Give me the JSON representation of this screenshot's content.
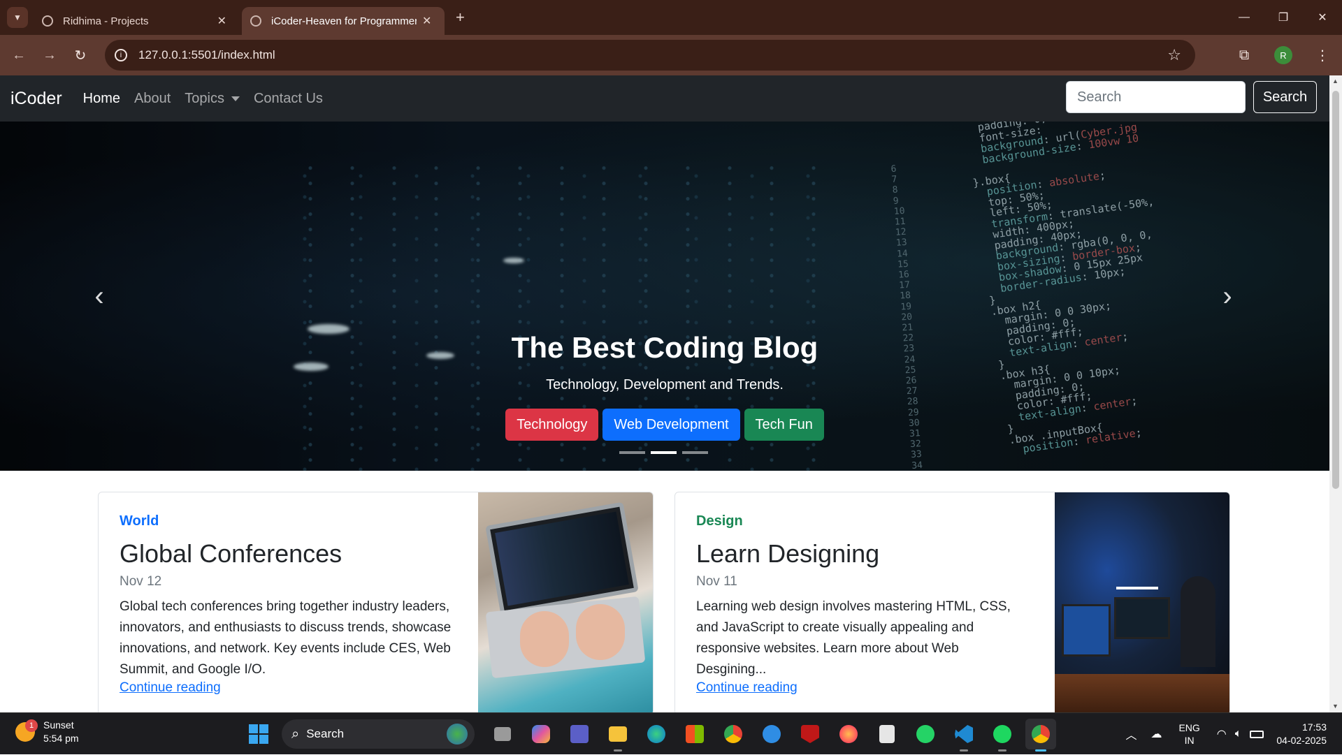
{
  "browser": {
    "tabs": [
      {
        "title": "Ridhima - Projects"
      },
      {
        "title": "iCoder-Heaven for Programmers"
      }
    ],
    "url": "127.0.0.1:5501/index.html",
    "profile_initial": "R"
  },
  "navbar": {
    "brand": "iCoder",
    "links": [
      "Home",
      "About",
      "Topics",
      "Contact Us"
    ],
    "active": "Home",
    "search_placeholder": "Search",
    "search_button": "Search"
  },
  "hero": {
    "title": "The Best Coding Blog",
    "subtitle": "Technology, Development and Trends.",
    "buttons": [
      {
        "label": "Technology",
        "color": "#dc3545"
      },
      {
        "label": "Web Development",
        "color": "#0d6efd"
      },
      {
        "label": "Tech Fun",
        "color": "#198754"
      }
    ],
    "active_slide": 2,
    "slide_count": 3
  },
  "cards": [
    {
      "category": "World",
      "category_color": "#0d6efd",
      "title": "Global Conferences",
      "date": "Nov 12",
      "text": "Global tech conferences bring together industry leaders, innovators, and enthusiasts to discuss trends, showcase innovations, and network. Key events include CES, Web Summit, and Google I/O.",
      "link": "Continue reading"
    },
    {
      "category": "Design",
      "category_color": "#198754",
      "title": "Learn Designing",
      "date": "Nov 11",
      "text": "Learning web design involves mastering HTML, CSS, and JavaScript to create visually appealing and responsive websites. Learn more about Web Desgining...",
      "link": "Continue reading"
    }
  ],
  "taskbar": {
    "weather_title": "Sunset",
    "weather_time": "5:54 pm",
    "weather_badge": "1",
    "search_label": "Search",
    "lang_1": "ENG",
    "lang_2": "IN",
    "time": "17:53",
    "date": "04-02-2025"
  }
}
